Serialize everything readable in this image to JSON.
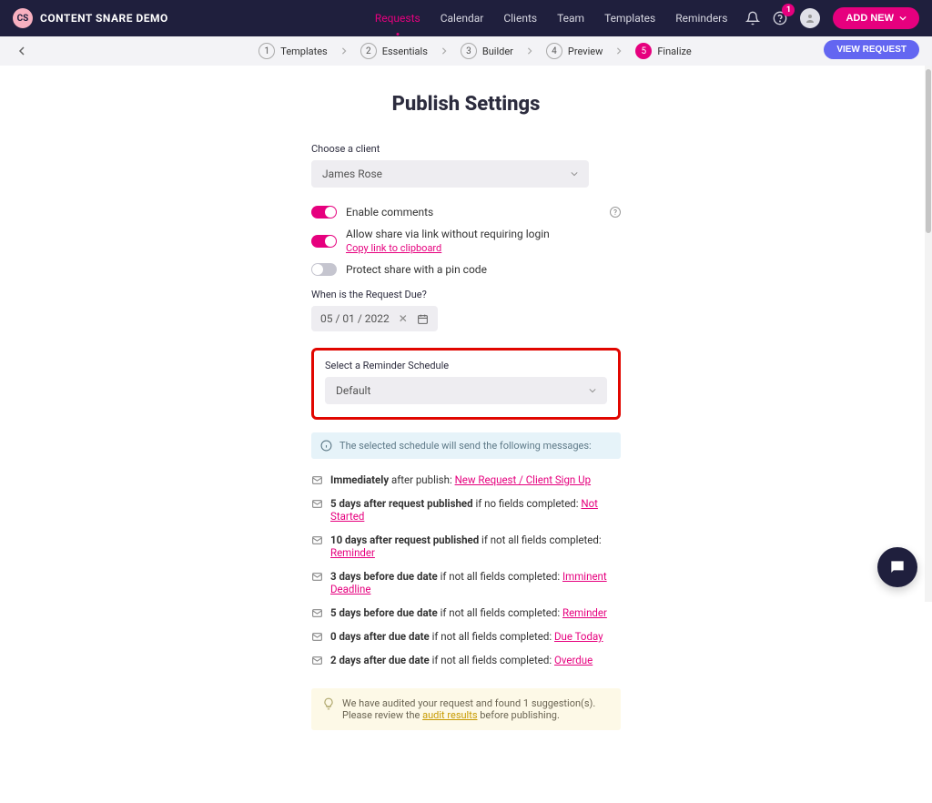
{
  "brand": {
    "badge": "CS",
    "name": "CONTENT SNARE DEMO"
  },
  "nav": {
    "links": [
      "Requests",
      "Calendar",
      "Clients",
      "Team",
      "Templates",
      "Reminders"
    ],
    "activeIndex": 0,
    "helpBadge": "1",
    "addNewLabel": "ADD NEW"
  },
  "stepper": {
    "steps": [
      "Templates",
      "Essentials",
      "Builder",
      "Preview",
      "Finalize"
    ],
    "activeIndex": 4,
    "viewRequestLabel": "VIEW REQUEST"
  },
  "page": {
    "title": "Publish Settings",
    "clientLabel": "Choose a client",
    "clientValue": "James Rose",
    "toggles": {
      "comments": "Enable comments",
      "shareLink": "Allow share via link without requiring login",
      "copyLink": "Copy link to clipboard",
      "pinProtect": "Protect share with a pin code"
    },
    "dueLabel": "When is the Request Due?",
    "dueValue": "05 / 01 / 2022",
    "reminderLabel": "Select a Reminder Schedule",
    "reminderValue": "Default",
    "scheduleInfo": "The selected schedule will send the following messages:",
    "schedule": [
      {
        "bold": "Immediately",
        "mid": " after publish: ",
        "link": "New Request / Client Sign Up"
      },
      {
        "bold": "5 days after request published",
        "mid": " if no fields completed: ",
        "link": "Not Started"
      },
      {
        "bold": "10 days after request published",
        "mid": " if not all fields completed: ",
        "link": "Reminder"
      },
      {
        "bold": "3 days before due date",
        "mid": " if not all fields completed: ",
        "link": "Imminent Deadline"
      },
      {
        "bold": "5 days before due date",
        "mid": " if not all fields completed: ",
        "link": "Reminder"
      },
      {
        "bold": "0 days after due date",
        "mid": " if not all fields completed: ",
        "link": "Due Today"
      },
      {
        "bold": "2 days after due date",
        "mid": " if not all fields completed: ",
        "link": "Overdue"
      }
    ],
    "audit": {
      "line1": "We have audited your request and found 1 suggestion(s).",
      "line2a": "Please review the ",
      "line2link": "audit results",
      "line2b": " before publishing."
    }
  }
}
